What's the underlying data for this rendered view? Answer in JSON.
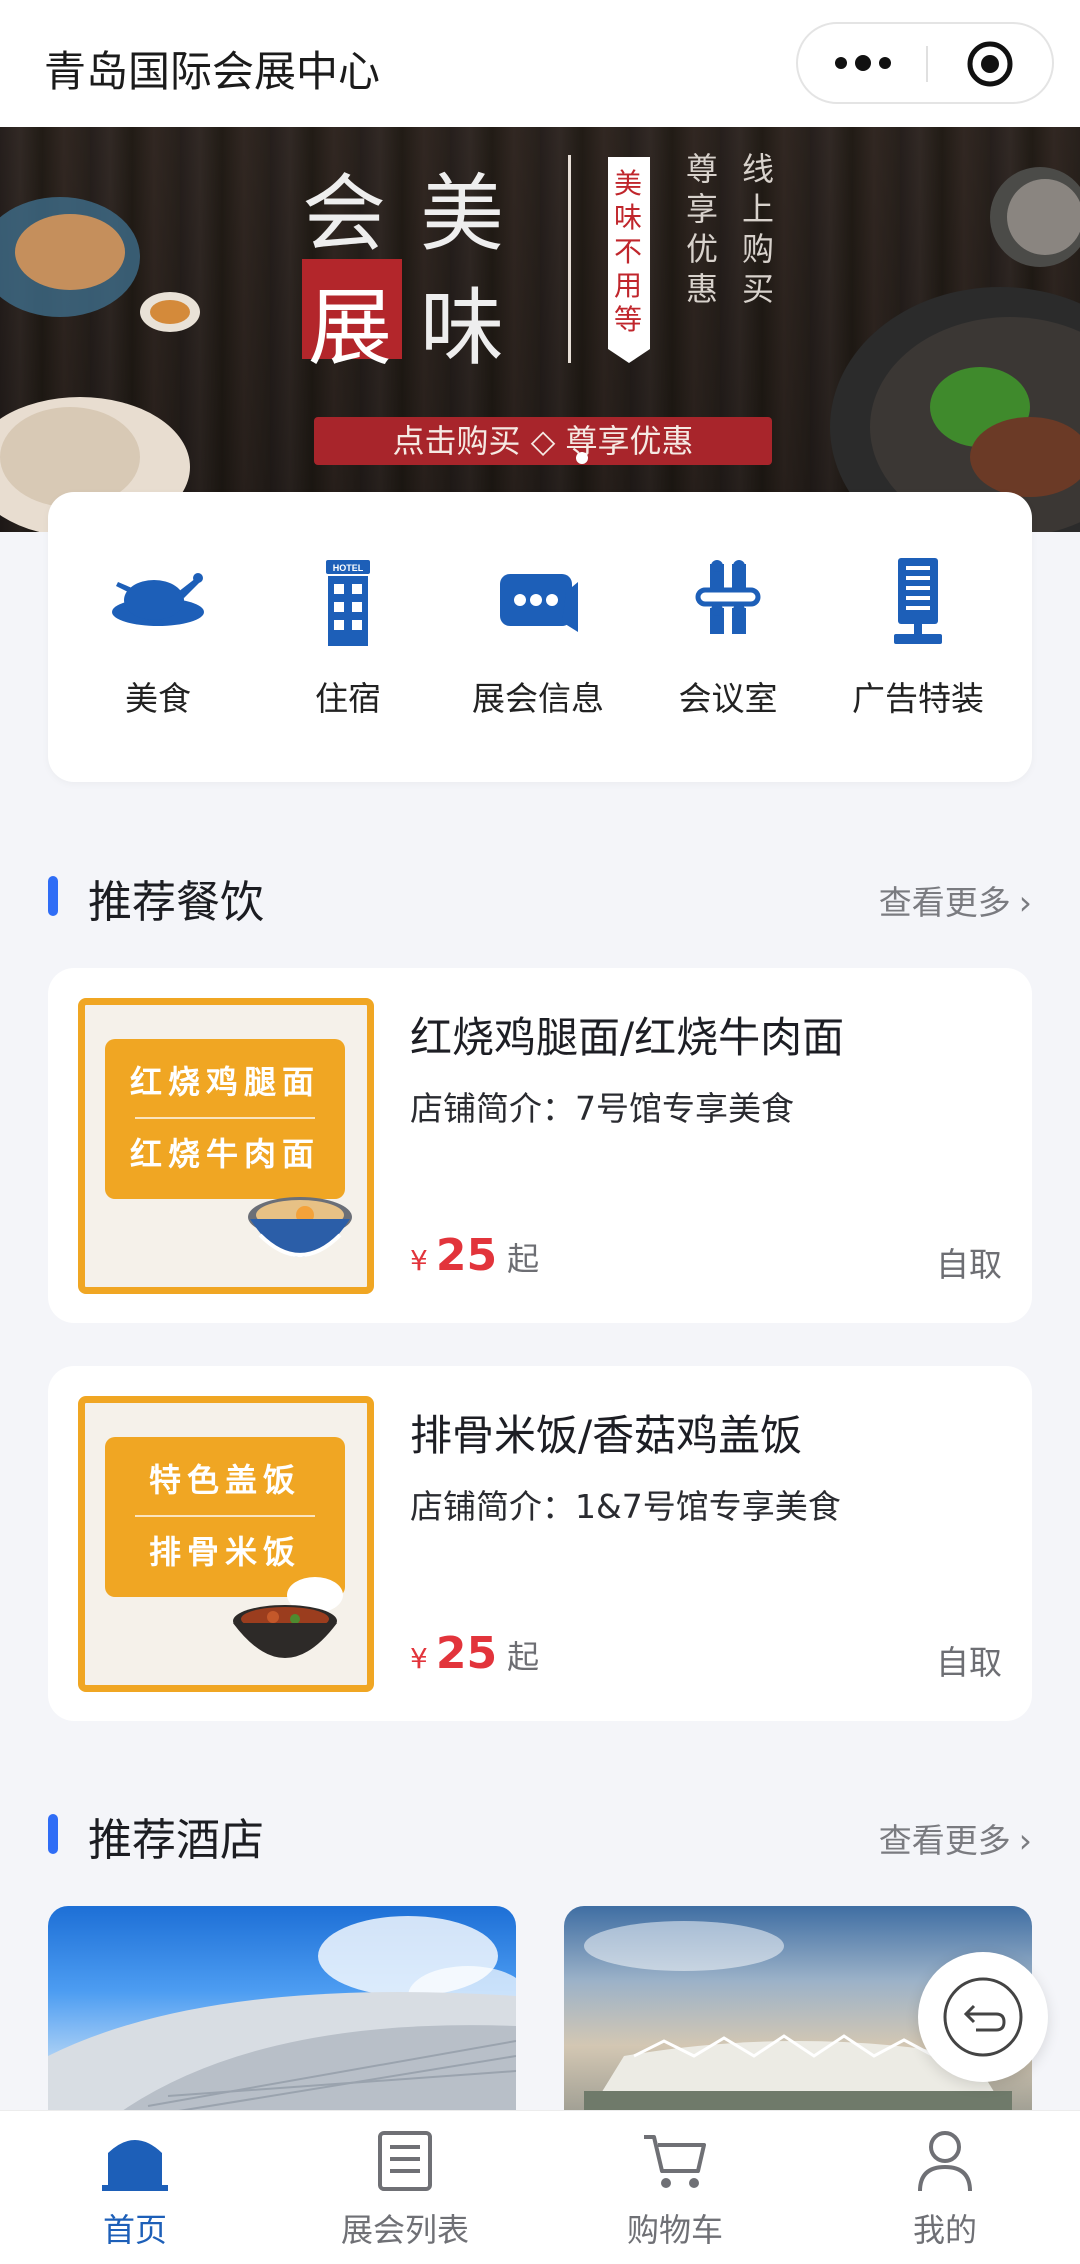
{
  "header": {
    "title": "青岛国际会展中心"
  },
  "banner": {
    "big_chars": [
      "会",
      "美",
      "展",
      "味"
    ],
    "ribbon_text": "美味不用等",
    "col1": "尊享优惠",
    "col2": "线上购买",
    "cta": "点击购买 ◇ 尊享优惠"
  },
  "categories": [
    {
      "label": "美食",
      "icon": "roast-chicken-icon"
    },
    {
      "label": "住宿",
      "icon": "hotel-icon"
    },
    {
      "label": "展会信息",
      "icon": "chat-bubble-icon"
    },
    {
      "label": "会议室",
      "icon": "meeting-room-icon"
    },
    {
      "label": "广告特装",
      "icon": "billboard-icon"
    }
  ],
  "dining": {
    "title": "推荐餐饮",
    "more": "查看更多",
    "items": [
      {
        "thumb_lines": [
          "红烧鸡腿面",
          "红烧牛肉面"
        ],
        "name": "红烧鸡腿面/红烧牛肉面",
        "desc": "店铺简介：7号馆专享美食",
        "currency": "¥",
        "price": "25",
        "price_suffix": "起",
        "pickup": "自取"
      },
      {
        "thumb_lines": [
          "特色盖饭",
          "排骨米饭"
        ],
        "name": "排骨米饭/香菇鸡盖饭",
        "desc": "店铺简介：1&7号馆专享美食",
        "currency": "¥",
        "price": "25",
        "price_suffix": "起",
        "pickup": "自取"
      }
    ]
  },
  "hotels": {
    "title": "推荐酒店",
    "more": "查看更多"
  },
  "tabbar": [
    {
      "label": "首页",
      "icon": "home-icon",
      "active": true
    },
    {
      "label": "展会列表",
      "icon": "list-icon",
      "active": false
    },
    {
      "label": "购物车",
      "icon": "cart-icon",
      "active": false
    },
    {
      "label": "我的",
      "icon": "user-icon",
      "active": false
    }
  ],
  "colors": {
    "accent": "#2f6df6",
    "brand_blue": "#1d5fb8",
    "price_red": "#e2343b",
    "food_orange": "#f0a623"
  }
}
